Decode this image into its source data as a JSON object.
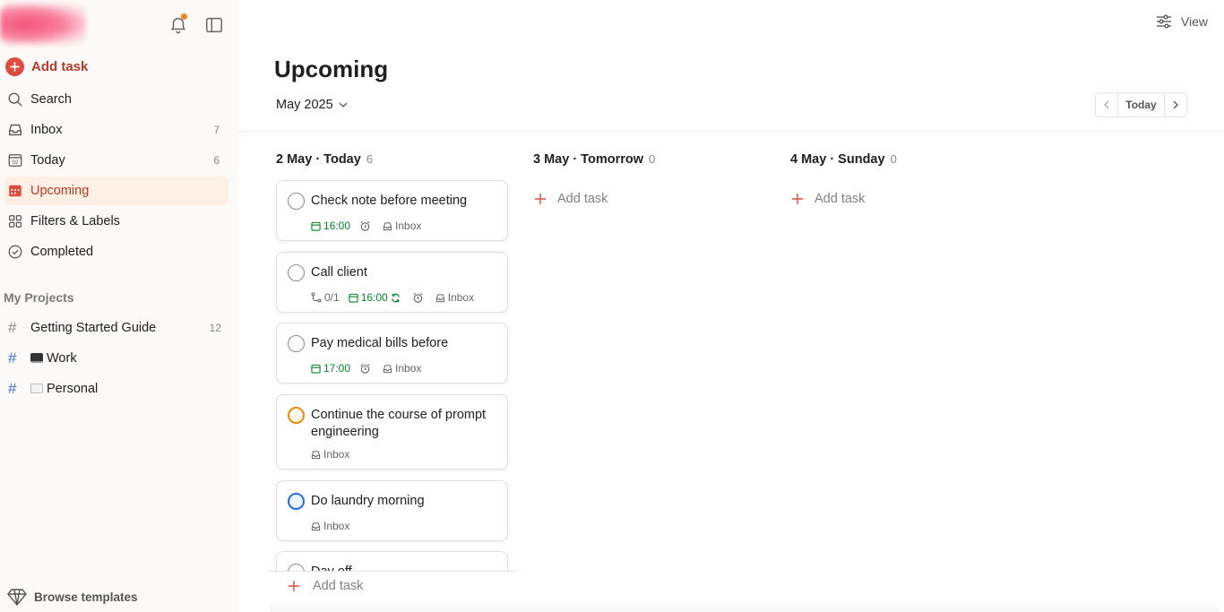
{
  "sidebar": {
    "add_task": "Add task",
    "nav": [
      {
        "label": "Search",
        "count": ""
      },
      {
        "label": "Inbox",
        "count": "7"
      },
      {
        "label": "Today",
        "count": "6"
      },
      {
        "label": "Upcoming",
        "count": ""
      },
      {
        "label": "Filters & Labels",
        "count": ""
      },
      {
        "label": "Completed",
        "count": ""
      }
    ],
    "today_icon_number": "02",
    "projects_title": "My Projects",
    "projects": [
      {
        "label": "Getting Started Guide",
        "count": "12"
      },
      {
        "label": "Work",
        "emoji": "laptop-icon"
      },
      {
        "label": "Personal",
        "emoji": "notepad-icon"
      }
    ],
    "browse_templates": "Browse templates"
  },
  "header": {
    "view": "View",
    "title": "Upcoming",
    "month": "May 2025",
    "today_button": "Today"
  },
  "columns": [
    {
      "date": "2 May · Today",
      "count": "6"
    },
    {
      "date": "3 May · Tomorrow",
      "count": "0",
      "add_task": "Add task"
    },
    {
      "date": "4 May · Sunday",
      "count": "0",
      "add_task": "Add task"
    }
  ],
  "tasks": [
    {
      "title": "Check note before meeting",
      "time": "16:00",
      "project": "Inbox"
    },
    {
      "title": "Call client",
      "subtasks": "0/1",
      "time": "16:00",
      "project": "Inbox"
    },
    {
      "title": "Pay medical bills before",
      "time": "17:00",
      "project": "Inbox"
    },
    {
      "title": "Continue the course of prompt engineering",
      "project": "Inbox",
      "priority": "orange"
    },
    {
      "title": "Do laundry morning",
      "project": "Inbox",
      "priority": "blue"
    },
    {
      "title": "Day off"
    }
  ],
  "bottom_add_task": "Add task",
  "colors": {
    "accent_red": "#dc4c3e",
    "active_bg": "#ffefe5",
    "due_green": "#058527",
    "priority_orange": "#eb8909",
    "priority_blue": "#246fe0"
  }
}
